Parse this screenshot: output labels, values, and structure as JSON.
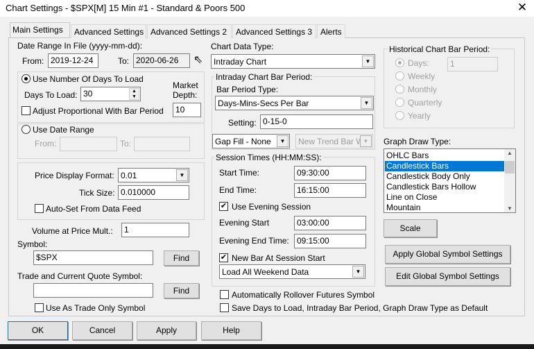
{
  "window": {
    "title": "Chart Settings - $SPX[M]  15 Min   #1 - Standard & Poors 500",
    "close": "✕"
  },
  "tabs": [
    "Main Settings",
    "Advanced Settings",
    "Advanced Settings 2",
    "Advanced Settings 3",
    "Alerts"
  ],
  "date_range": {
    "label": "Date Range In File (yyyy-mm-dd):",
    "from_label": "From:",
    "from": "2019-12-24",
    "to_label": "To:",
    "to": "2020-06-26"
  },
  "days_group": {
    "radio_label": "Use Number Of Days To Load",
    "days_label": "Days To Load:",
    "days": "30",
    "market_depth_label1": "Market",
    "market_depth_label2": "Depth:",
    "market_depth": "10",
    "adjust_label": "Adjust Proportional With Bar Period"
  },
  "date_range_group": {
    "radio_label": "Use Date Range",
    "from_label": "From:",
    "to_label": "To:"
  },
  "price_group": {
    "format_label": "Price Display Format:",
    "format": "0.01",
    "tick_label": "Tick Size:",
    "tick": "0.010000",
    "autoset_label": "Auto-Set From Data Feed"
  },
  "volume": {
    "label": "Volume at Price Mult.:",
    "value": "1"
  },
  "symbol": {
    "label": "Symbol:",
    "value": "$SPX",
    "find": "Find"
  },
  "trade_symbol": {
    "label": "Trade and Current Quote Symbol:",
    "value": "",
    "find": "Find",
    "trade_only_label": "Use As Trade Only Symbol"
  },
  "chart_data_type": {
    "label": "Chart Data Type:",
    "value": "Intraday Chart"
  },
  "intraday": {
    "legend": "Intraday Chart Bar Period:",
    "type_label": "Bar Period Type:",
    "type": "Days-Mins-Secs Per Bar",
    "setting_label": "Setting:",
    "setting": "0-15-0",
    "gap_fill": "Gap Fill - None",
    "new_trend": "New Trend Bar W"
  },
  "session": {
    "legend": "Session Times (HH:MM:SS):",
    "start_label": "Start Time:",
    "start": "09:30:00",
    "end_label": "End Time:",
    "end": "16:15:00",
    "evening_label": "Use Evening Session",
    "evening_start_label": "Evening Start",
    "evening_start": "03:00:00",
    "evening_end_label": "Evening End Time:",
    "evening_end": "09:15:00",
    "new_bar_label": "New Bar At Session Start",
    "weekend": "Load All Weekend Data"
  },
  "rollover_label": "Automatically Rollover Futures Symbol",
  "save_default_label": "Save Days to Load, Intraday Bar Period, Graph Draw Type as Default",
  "historical": {
    "legend": "Historical Chart Bar Period:",
    "options": [
      "Days:",
      "Weekly",
      "Monthly",
      "Quarterly",
      "Yearly"
    ],
    "days": "1"
  },
  "graph_draw": {
    "label": "Graph Draw Type:",
    "items": [
      "OHLC Bars",
      "Candlestick Bars",
      "Candlestick Body Only",
      "Candlestick Bars Hollow",
      "Line on Close",
      "Mountain"
    ],
    "selected": "Candlestick Bars"
  },
  "buttons": {
    "scale": "Scale",
    "apply_global": "Apply Global Symbol Settings",
    "edit_global": "Edit Global Symbol Settings",
    "ok": "OK",
    "cancel": "Cancel",
    "apply": "Apply",
    "help": "Help"
  }
}
